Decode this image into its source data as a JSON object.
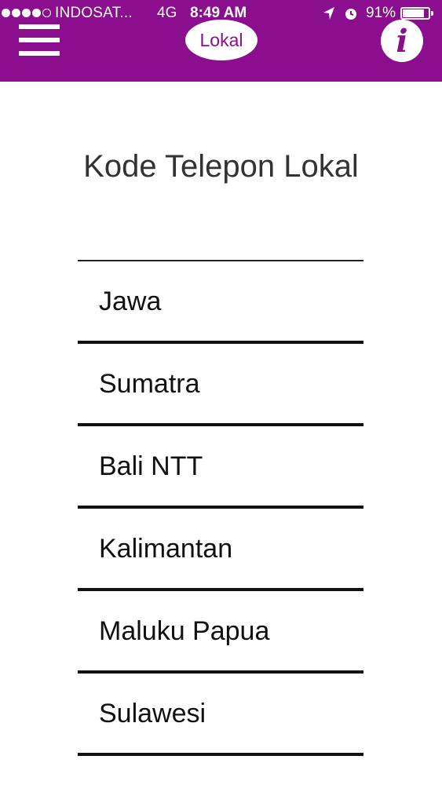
{
  "status_bar": {
    "carrier": "INDOSAT...",
    "network": "4G",
    "time": "8:49 AM",
    "battery": "91%",
    "battery_level": 0.91,
    "signal_bars_filled": 4,
    "signal_bars_total": 5
  },
  "header": {
    "menu_icon": "hamburger-menu-icon",
    "title": "Lokal",
    "info_icon": "info-icon",
    "info_glyph": "i",
    "background_color": "#8a0e8e"
  },
  "main": {
    "title": "Kode Telepon Lokal",
    "regions": [
      {
        "label": "Jawa"
      },
      {
        "label": "Sumatra"
      },
      {
        "label": "Bali NTT"
      },
      {
        "label": "Kalimantan"
      },
      {
        "label": "Maluku Papua"
      },
      {
        "label": "Sulawesi"
      }
    ]
  }
}
